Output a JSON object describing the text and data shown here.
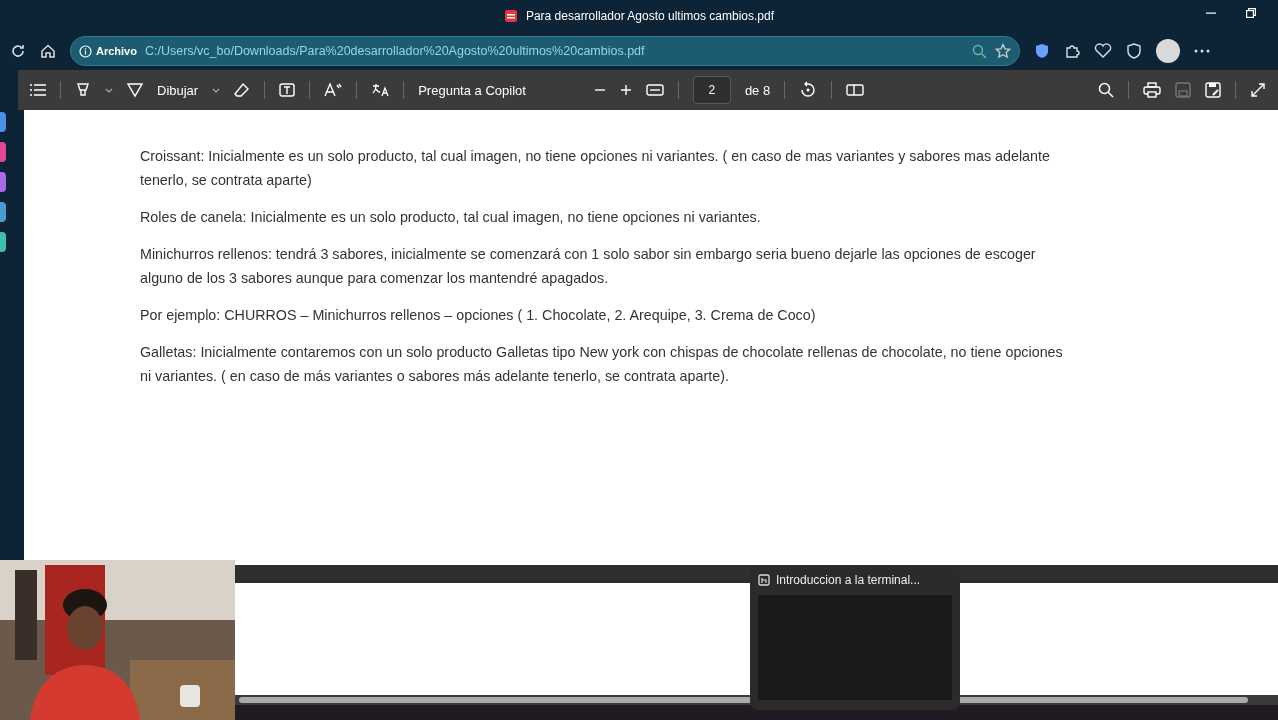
{
  "window": {
    "title": "Para desarrollador Agosto ultimos cambios.pdf"
  },
  "address_bar": {
    "scheme_label": "Archivo",
    "url": "C:/Users/vc_bo/Downloads/Para%20desarrollador%20Agosto%20ultimos%20cambios.pdf"
  },
  "pdf_toolbar": {
    "draw_label": "Dibujar",
    "copilot_label": "Pregunta a Copilot",
    "page_number": "2",
    "page_count": "de 8"
  },
  "sidebar": {
    "items": [
      {
        "color": "#4a8fe8"
      },
      {
        "color": "#e8459a"
      },
      {
        "color": "#a86be8"
      },
      {
        "color": "#4a9ad0"
      },
      {
        "color": "#3fbfb0"
      }
    ]
  },
  "document": {
    "paragraphs": [
      {
        "lines": [
          "Croissant: Inicialmente es un solo producto, tal cual imagen, no tiene opciones ni variantes. ( en caso de mas variantes y sabores mas adelante",
          "tenerlo, se contrata aparte)"
        ]
      },
      {
        "lines": [
          "Roles de canela: Inicialmente es un solo producto, tal cual imagen, no tiene opciones ni variantes."
        ]
      },
      {
        "lines": [
          "Minichurros rellenos: tendrá 3 sabores, inicialmente se comenzará con 1 solo sabor sin embargo seria bueno dejarle las opciones de escoger",
          "alguno de los 3 sabores aunque para comenzar los mantendré apagados."
        ]
      },
      {
        "lines": [
          "Por ejemplo: CHURROS – Minichurros rellenos – opciones ( 1. Chocolate, 2. Arequipe, 3. Crema de Coco)"
        ]
      },
      {
        "lines": [
          "Galletas: Inicialmente contaremos con un solo producto Galletas tipo New york con chispas de chocolate rellenas de chocolate, no tiene opciones",
          "ni variantes. ( en caso de más variantes o sabores más  adelante tenerlo, se contrata aparte)."
        ]
      }
    ]
  },
  "taskbar_preview": {
    "title": "Introduccion a la terminal..."
  }
}
